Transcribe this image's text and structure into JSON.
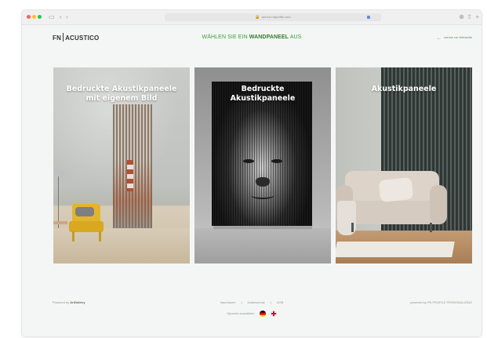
{
  "browser": {
    "url": "act.rico.fnprofile.com",
    "back_icon": "chevron-left-icon",
    "forward_icon": "chevron-right-icon"
  },
  "header": {
    "logo_left": "FN",
    "logo_right": "ACUSTICO",
    "title_prefix": "WÄHLEN SIE EIN",
    "title_bold": "WANDPANEEL",
    "title_suffix": "AUS",
    "back_link": "zurück zur Webseite"
  },
  "cards": [
    {
      "title_line1": "Bedruckte Akustikpaneele",
      "title_line2": "mit eigenem Bild"
    },
    {
      "title_line1": "Bedruckte",
      "title_line2": "Akustikpaneele"
    },
    {
      "title_line1": "Akustikpaneele",
      "title_line2": ""
    }
  ],
  "footer": {
    "left_prefix": "Powered by",
    "left_brand": "ArtGallery",
    "links": [
      "Impressum",
      "Datenschutz",
      "AGB"
    ],
    "right": "powered by FN PROFILE PERSONALIZING",
    "language_label": "Sprache auswählen"
  },
  "colors": {
    "accent_green": "#3b9b3f",
    "background": "#f4f6f5"
  }
}
